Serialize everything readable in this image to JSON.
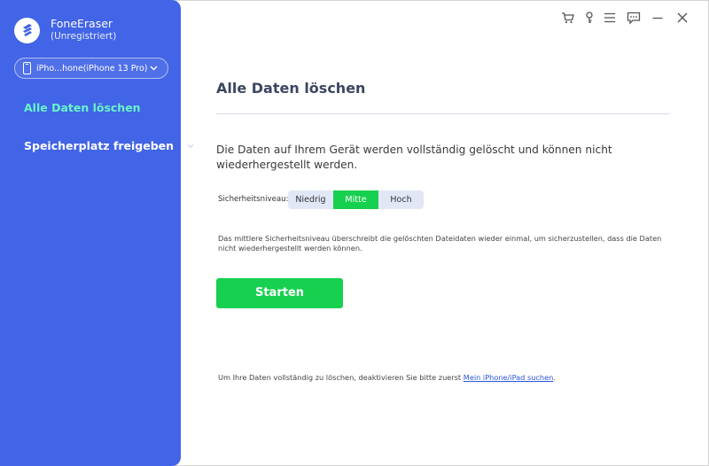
{
  "app": {
    "name": "FoneEraser",
    "status": "(Unregistriert)"
  },
  "device": {
    "label": "iPho...hone(iPhone 13 Pro)"
  },
  "sidebar": {
    "items": [
      {
        "label": "Alle Daten löschen",
        "active": true
      },
      {
        "label": "Speicherplatz freigeben",
        "active": false
      }
    ]
  },
  "titlebar": {
    "icons": [
      "cart-icon",
      "key-icon",
      "menu-icon",
      "feedback-icon",
      "minimize-icon",
      "close-icon"
    ]
  },
  "main": {
    "title": "Alle Daten löschen",
    "description": "Die Daten auf Ihrem Gerät werden vollständig gelöscht und können nicht wiederhergestellt werden.",
    "security_label": "Sicherheitsniveau:",
    "levels": [
      "Niedrig",
      "Mitte",
      "Hoch"
    ],
    "selected_level": "Mitte",
    "level_note": "Das mittlere Sicherheitsniveau überschreibt die gelöschten Dateidaten wieder einmal, um sicherzustellen, dass die Daten nicht wiederhergestellt werden können.",
    "start_label": "Starten",
    "footer_text": "Um Ihre Daten vollständig zu löschen, deaktivieren Sie bitte zuerst",
    "footer_link": "Mein iPhone/iPad suchen",
    "footer_end": "."
  },
  "colors": {
    "sidebar": "#4264e6",
    "active_nav": "#66f5c8",
    "accent_green": "#18d04f",
    "link": "#2a55d8"
  }
}
